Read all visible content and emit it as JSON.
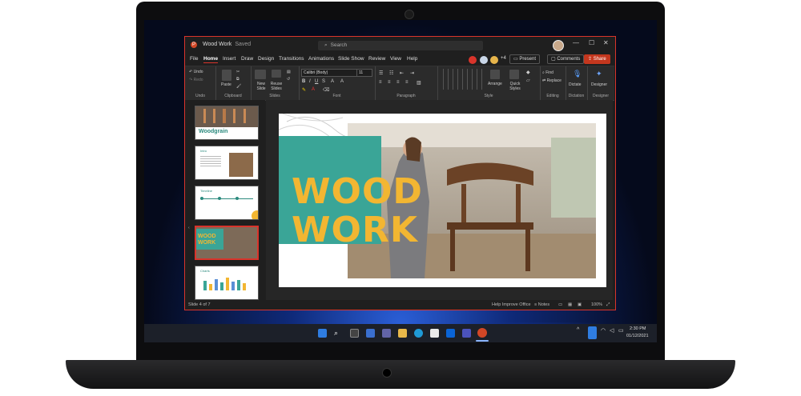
{
  "window": {
    "doc_title": "Wood Work",
    "save_status": "Saved",
    "search_placeholder": "Search",
    "collab_extra": "+4"
  },
  "menu": [
    "File",
    "Home",
    "Insert",
    "Draw",
    "Design",
    "Transitions",
    "Animations",
    "Slide Show",
    "Review",
    "View",
    "Help"
  ],
  "menu_active": "Home",
  "actions": {
    "present": "Present",
    "comments": "Comments",
    "share": "Share"
  },
  "ribbon": {
    "undo": "Undo",
    "redo": "Redo",
    "paste": "Paste",
    "new_slide": "New Slide",
    "reuse_slides": "Reuse Slides",
    "font_name": "Calibri (Body)",
    "font_size": "11",
    "arrange": "Arrange",
    "quick_styles": "Quick Styles",
    "find": "Find",
    "replace": "Replace",
    "dictate": "Dictate",
    "designer": "Designer",
    "groups": [
      "Undo",
      "Clipboard",
      "Slides",
      "Font",
      "Paragraph",
      "Style",
      "Editing",
      "Dictation",
      "Designer"
    ]
  },
  "thumbnails": {
    "t1_title": "Woodgrain",
    "t2_title": "Intro",
    "t3_title": "Timeline",
    "t4_title": "WOOD WORK",
    "t5_title": "Charts"
  },
  "slide": {
    "line1": "WOOD",
    "line2": "WORK"
  },
  "status": {
    "slide_pos": "Slide 4 of 7",
    "improve": "Help Improve Office",
    "notes": "Notes",
    "zoom": "100%"
  },
  "taskbar": {
    "time": "2:30 PM",
    "date": "01/12/2021"
  },
  "colors": {
    "accent": "#d9342b",
    "title_yellow": "#f2b632",
    "teal": "#3aa597"
  }
}
